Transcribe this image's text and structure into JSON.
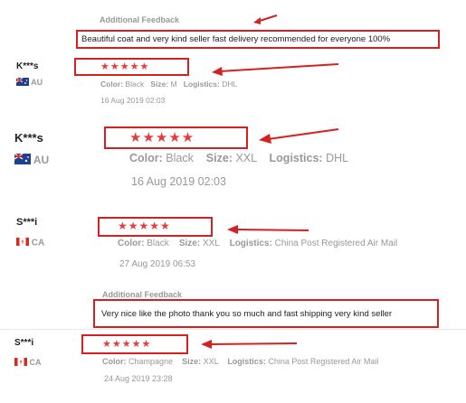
{
  "reviews": [
    {
      "feedback_label": "Additional Feedback",
      "feedback_text": "Beautiful coat and very kind seller fast delivery recommended for everyone 100%"
    },
    {
      "user": "K***s",
      "country": "AU",
      "stars": "★★★★★",
      "color_label": "Color:",
      "color": "Black",
      "size_label": "Size:",
      "size": "M",
      "logistics_label": "Logistics:",
      "logistics": "DHL",
      "date": "16 Aug 2019 02:03"
    },
    {
      "user": "K***s",
      "country": "AU",
      "stars": "★★★★★",
      "color_label": "Color:",
      "color": "Black",
      "size_label": "Size:",
      "size": "XXL",
      "logistics_label": "Logistics:",
      "logistics": "DHL",
      "date": "16 Aug 2019 02:03"
    },
    {
      "user": "S***i",
      "country": "CA",
      "stars": "★★★★★",
      "color_label": "Color:",
      "color": "Black",
      "size_label": "Size:",
      "size": "XXL",
      "logistics_label": "Logistics:",
      "logistics": "China Post Registered Air Mail",
      "date": "27 Aug 2019 06:53",
      "feedback_label": "Additional Feedback",
      "feedback_text": "Very nice like the photo thank you so much and fast shipping very kind seller"
    },
    {
      "user": "S***i",
      "country": "CA",
      "stars": "★★★★★",
      "color_label": "Color:",
      "color": "Champagne",
      "size_label": "Size:",
      "size": "XXL",
      "logistics_label": "Logistics:",
      "logistics": "China Post Registered Air Mail",
      "date": "24 Aug 2019 23:28"
    }
  ],
  "colors": {
    "annotation_red": "#d62020",
    "star_red": "#e83a3a",
    "meta_gray": "#999999"
  }
}
